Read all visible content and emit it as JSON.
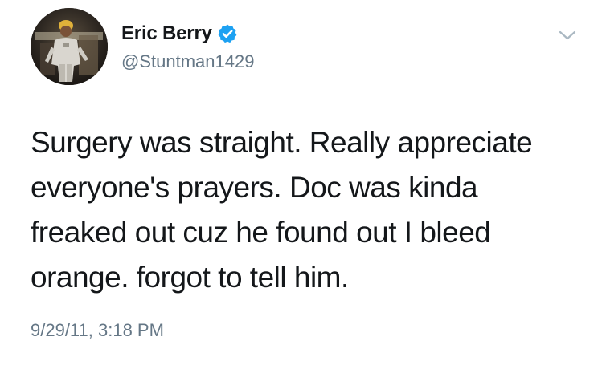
{
  "tweet": {
    "author": {
      "display_name": "Eric Berry",
      "handle": "@Stuntman1429",
      "verified": true,
      "verified_icon": "verified-badge-icon",
      "avatar_icon": "profile-photo"
    },
    "text_lines": [
      "Surgery was straight. Really appreciate",
      "everyone's prayers. Doc was kinda",
      "freaked out cuz he found out I bleed",
      "orange. forgot to tell him."
    ],
    "timestamp": "9/29/11, 3:18 PM",
    "menu_icon": "chevron-down-icon"
  },
  "colors": {
    "text_primary": "#14171a",
    "text_secondary": "#657786",
    "verified_blue": "#1da1f2",
    "caret_gray": "#aab8c2"
  }
}
